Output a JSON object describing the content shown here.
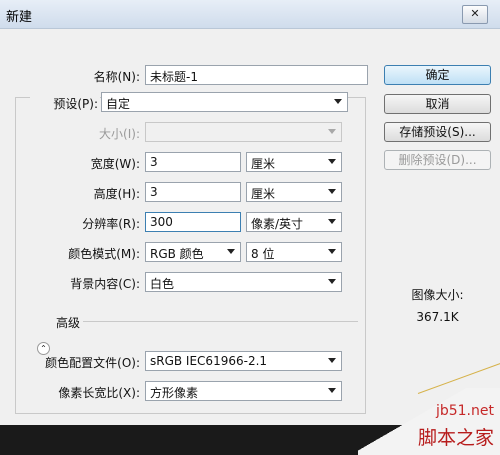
{
  "window": {
    "title": "新建",
    "close_glyph": "✕"
  },
  "form": {
    "name": {
      "label": "名称(N):",
      "value": "未标题-1"
    },
    "preset": {
      "label": "预设(P):",
      "value": "自定"
    },
    "size": {
      "label": "大小(I):",
      "value": ""
    },
    "width": {
      "label": "宽度(W):",
      "value": "3",
      "unit": "厘米"
    },
    "height": {
      "label": "高度(H):",
      "value": "3",
      "unit": "厘米"
    },
    "resolution": {
      "label": "分辨率(R):",
      "value": "300",
      "unit": "像素/英寸"
    },
    "color_mode": {
      "label": "颜色模式(M):",
      "value": "RGB 颜色",
      "bits": "8 位"
    },
    "background": {
      "label": "背景内容(C):",
      "value": "白色"
    },
    "advanced": {
      "label": "高级",
      "toggle_glyph": "⌃"
    },
    "color_profile": {
      "label": "颜色配置文件(O):",
      "value": "sRGB IEC61966-2.1"
    },
    "pixel_aspect": {
      "label": "像素长宽比(X):",
      "value": "方形像素"
    }
  },
  "buttons": {
    "ok": "确定",
    "cancel": "取消",
    "save_preset": "存储预设(S)...",
    "delete_preset": "删除预设(D)..."
  },
  "image_size": {
    "label": "图像大小:",
    "value": "367.1K"
  },
  "watermark": {
    "url": "jb51.net",
    "name": "脚本之家"
  }
}
